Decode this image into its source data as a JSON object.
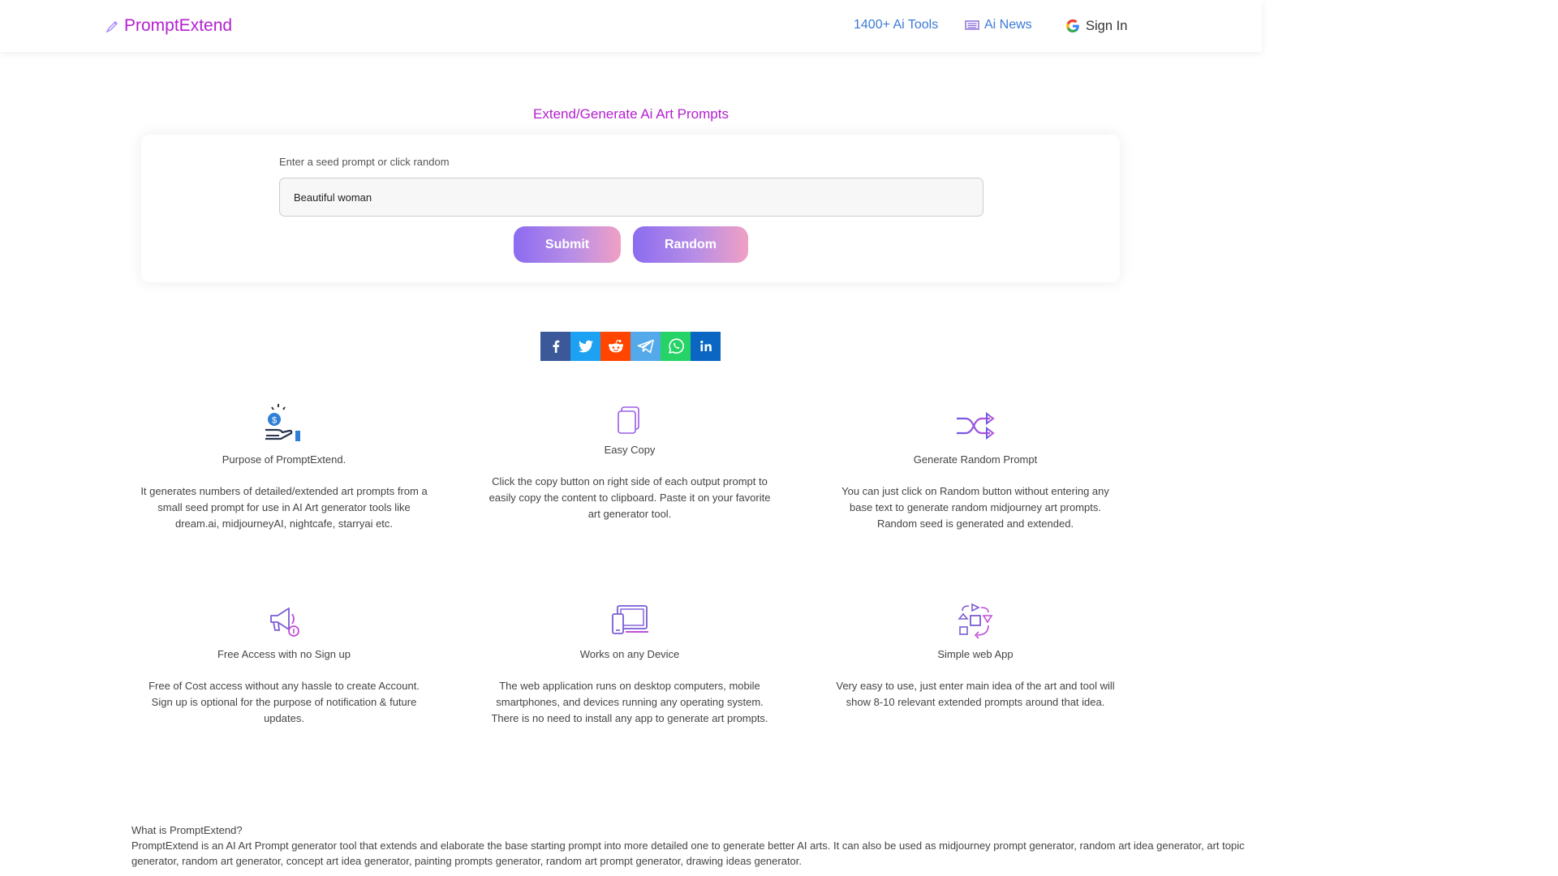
{
  "header": {
    "brand": "PromptExtend",
    "nav": {
      "tools": "1400+ Ai Tools",
      "news": "Ai News",
      "signin": "Sign In"
    }
  },
  "main": {
    "title": "Extend/Generate Ai Art Prompts",
    "seed_label": "Enter a seed prompt or click random",
    "seed_value": "Beautiful woman",
    "submit_label": "Submit",
    "random_label": "Random"
  },
  "share": [
    "facebook-icon",
    "twitter-icon",
    "reddit-icon",
    "telegram-icon",
    "whatsapp-icon",
    "linkedin-icon"
  ],
  "features": [
    {
      "title": "Purpose of PromptExtend.",
      "desc": "It generates numbers of detailed/extended art prompts from a small seed prompt for use in AI Art generator tools like dream.ai, midjourneyAI, nightcafe, starryai etc."
    },
    {
      "title": "Easy Copy",
      "desc": "Click the copy button on right side of each output prompt to easily copy the content to clipboard. Paste it on your favorite art generator tool."
    },
    {
      "title": "Generate Random Prompt",
      "desc": "You can just click on Random button without entering any base text to generate random midjourney art prompts. Random seed is generated and extended."
    },
    {
      "title": "Free Access with no Sign up",
      "desc": "Free of Cost access without any hassle to create Account. Sign up is optional for the purpose of notification & future updates."
    },
    {
      "title": "Works on any Device",
      "desc": "The web application runs on desktop computers, mobile smartphones, and devices running any operating system. There is no need to install any app to generate art prompts."
    },
    {
      "title": "Simple web App",
      "desc": "Very easy to use, just enter main idea of the art and tool will show 8-10 relevant extended prompts around that idea."
    }
  ],
  "about": {
    "heading": "What is PromptExtend?",
    "body": "PromptExtend is an AI Art Prompt generator tool that extends and elaborate the base starting prompt into more detailed one to generate better AI arts. It can also be used as midjourney prompt generator, random art idea generator, art topic generator, random art generator, concept art idea generator, painting prompts generator, random art prompt generator, drawing ideas generator."
  },
  "colors": {
    "brand": "#b41fd0",
    "nav_link": "#3b7ad8",
    "button_gradient_start": "#8c6cf0",
    "button_gradient_end": "#f0a0c4"
  }
}
